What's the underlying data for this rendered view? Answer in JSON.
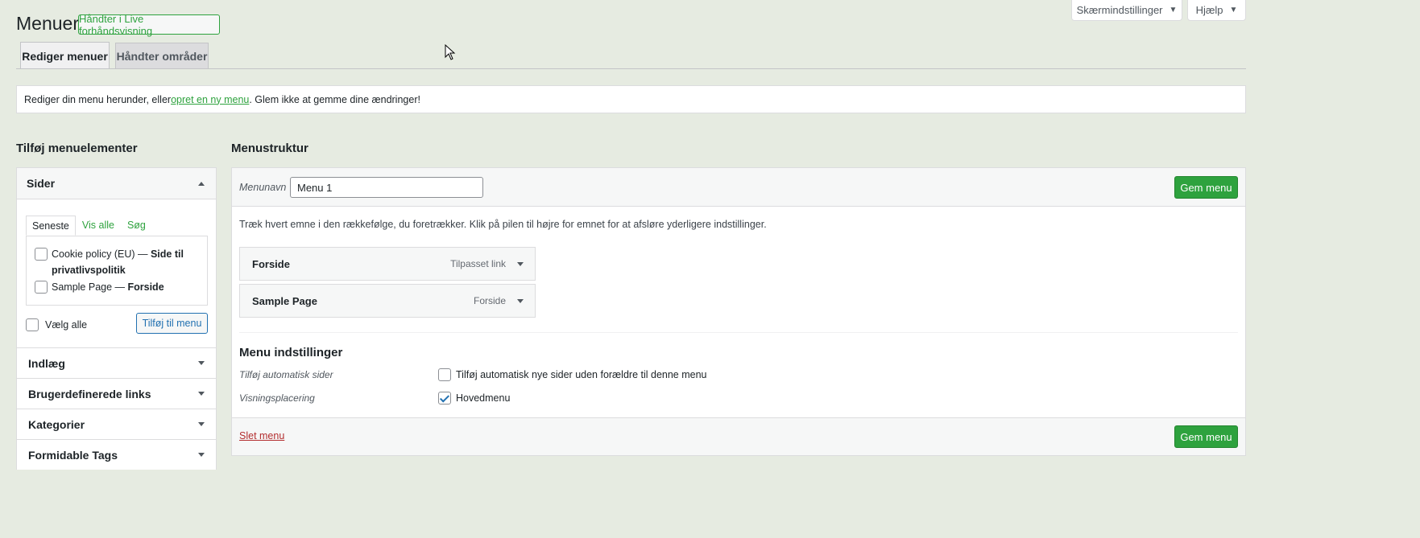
{
  "header": {
    "title": "Menuer",
    "live_preview_label": "Håndter i Live forhåndsvisning",
    "screen_options_label": "Skærmindstillinger",
    "help_label": "Hjælp"
  },
  "tabs": [
    {
      "label": "Rediger menuer",
      "active": true
    },
    {
      "label": "Håndter områder",
      "active": false
    }
  ],
  "notice": {
    "before": "Rediger din menu herunder, eller ",
    "link": "opret en ny menu",
    "after": ". Glem ikke at gemme dine ændringer!"
  },
  "left": {
    "heading": "Tilføj menuelementer",
    "pages_section": {
      "title": "Sider",
      "tabs": [
        "Seneste",
        "Vis alle",
        "Søg"
      ],
      "items": [
        {
          "label": "Cookie policy (EU) — ",
          "suffix": "Side til privatlivspolitik",
          "checked": false
        },
        {
          "label": "Sample Page — ",
          "suffix": "Forside",
          "checked": false
        }
      ],
      "select_all_label": "Vælg alle",
      "add_button": "Tilføj til menu"
    },
    "sections": [
      "Indlæg",
      "Brugerdefinerede links",
      "Kategorier",
      "Formidable Tags"
    ]
  },
  "right": {
    "heading": "Menustruktur",
    "menu_name_label": "Menunavn",
    "menu_name_value": "Menu 1",
    "save_label": "Gem menu",
    "instructions": "Træk hvert emne i den rækkefølge, du foretrækker. Klik på pilen til højre for emnet for at afsløre yderligere indstillinger.",
    "items": [
      {
        "title": "Forside",
        "type": "Tilpasset link"
      },
      {
        "title": "Sample Page",
        "type": "Forside"
      }
    ],
    "settings": {
      "heading": "Menu indstillinger",
      "auto_add_label": "Tilføj automatisk sider",
      "auto_add_option": "Tilføj automatisk nye sider uden forældre til denne menu",
      "auto_add_checked": false,
      "location_label": "Visningsplacering",
      "location_option": "Hovedmenu",
      "location_checked": true
    },
    "delete_label": "Slet menu"
  },
  "colors": {
    "background": "#e6ebe1",
    "accent_green": "#2ea23e",
    "delete_red": "#b32d2e"
  }
}
